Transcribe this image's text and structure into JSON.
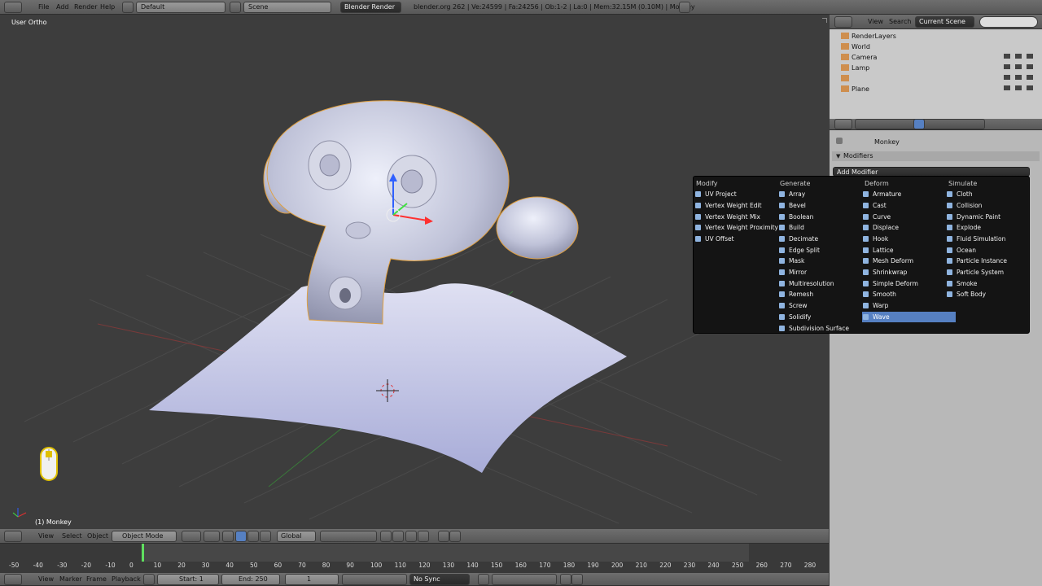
{
  "top_bar": {
    "menus": [
      "File",
      "Add",
      "Render",
      "Help"
    ],
    "screen_layout": "Default",
    "scene": "Scene",
    "engine": "Blender Render",
    "info": "blender.org 262 | Ve:24599 | Fa:24256 | Ob:1-2 | La:0 | Mem:32.15M (0.10M) | Monkey"
  },
  "viewport": {
    "view_label": "User Ortho",
    "object_label": "(1) Monkey"
  },
  "view3d_header": {
    "menus": [
      "View",
      "Select",
      "Object"
    ],
    "mode": "Object Mode",
    "orientation": "Global"
  },
  "outliner": {
    "menus": [
      "View",
      "Search"
    ],
    "scene_select": "Current Scene",
    "items": [
      "RenderLayers",
      "World",
      "Camera",
      "Lamp",
      "",
      "Plane"
    ]
  },
  "properties": {
    "breadcrumb": "Monkey",
    "panel_title": "Modifiers",
    "add_modifier": "Add Modifier"
  },
  "modifier_menu": {
    "columns": [
      {
        "title": "Modify",
        "items": [
          "UV Project",
          "Vertex Weight Edit",
          "Vertex Weight Mix",
          "Vertex Weight Proximity",
          "UV Offset"
        ]
      },
      {
        "title": "Generate",
        "items": [
          "Array",
          "Bevel",
          "Boolean",
          "Build",
          "Decimate",
          "Edge Split",
          "Mask",
          "Mirror",
          "Multiresolution",
          "Remesh",
          "Screw",
          "Solidify",
          "Subdivision Surface"
        ]
      },
      {
        "title": "Deform",
        "items": [
          "Armature",
          "Cast",
          "Curve",
          "Displace",
          "Hook",
          "Lattice",
          "Mesh Deform",
          "Shrinkwrap",
          "Simple Deform",
          "Smooth",
          "Warp",
          "Wave"
        ]
      },
      {
        "title": "Simulate",
        "items": [
          "Cloth",
          "Collision",
          "Dynamic Paint",
          "Explode",
          "Fluid Simulation",
          "Ocean",
          "Particle Instance",
          "Particle System",
          "Smoke",
          "Soft Body"
        ]
      }
    ],
    "highlighted": "Wave"
  },
  "timeline": {
    "ticks": [
      "-50",
      "-40",
      "-30",
      "-20",
      "-10",
      "0",
      "10",
      "20",
      "30",
      "40",
      "50",
      "60",
      "70",
      "80",
      "90",
      "100",
      "110",
      "120",
      "130",
      "140",
      "150",
      "160",
      "170",
      "180",
      "190",
      "200",
      "210",
      "220",
      "230",
      "240",
      "250",
      "260",
      "270",
      "280"
    ]
  },
  "timeline_footer": {
    "menus": [
      "View",
      "Marker",
      "Frame",
      "Playback"
    ],
    "start": "Start: 1",
    "end": "End: 250",
    "current": "1",
    "sync": "No Sync"
  }
}
